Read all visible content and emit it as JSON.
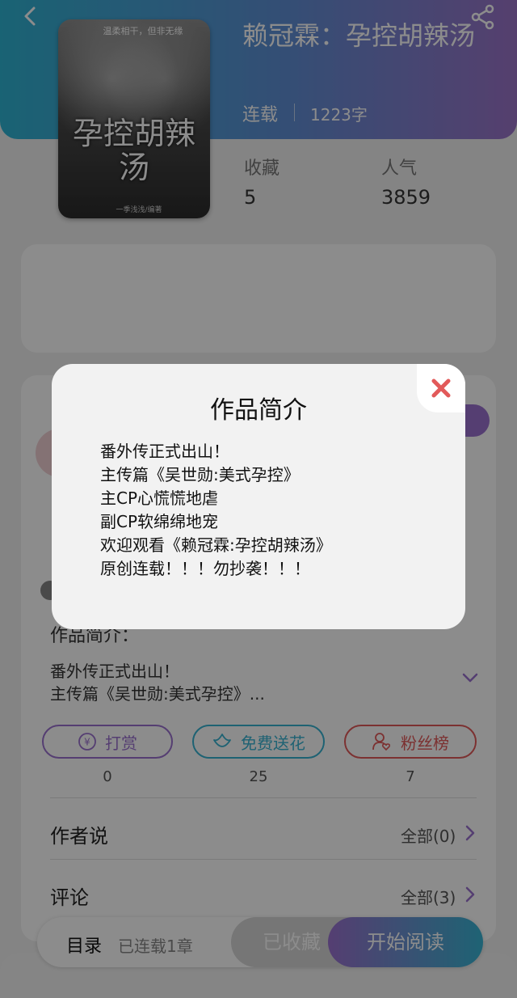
{
  "header": {
    "book_title": "赖冠霖：孕控胡辣汤",
    "status": "连载",
    "word_count": "1223字"
  },
  "cover": {
    "tagline": "温柔相干，但非无缘",
    "title": "孕控胡辣汤",
    "credit": "一季浅浅/编著"
  },
  "stats": {
    "favorites_label": "收藏",
    "favorites_value": "5",
    "popularity_label": "人气",
    "popularity_value": "3859"
  },
  "intro": {
    "heading": "作品简介：",
    "preview_line1": "番外传正式出山！",
    "preview_line2": "主传篇《吴世勋:美式孕控》..."
  },
  "actions": {
    "tip_label": "打赏",
    "tip_count": "0",
    "flower_label": "免费送花",
    "flower_count": "25",
    "fans_label": "粉丝榜",
    "fans_count": "7"
  },
  "sections": {
    "author_label": "作者说",
    "author_all": "全部(0)",
    "comment_label": "评论",
    "comment_all": "全部(3)"
  },
  "bottom_bar": {
    "toc_label": "目录",
    "toc_count": "已连载1章",
    "saved_label": "已收藏",
    "read_label": "开始阅读"
  },
  "modal": {
    "title": "作品简介",
    "lines": [
      "番外传正式出山！",
      "主传篇《吴世勋:美式孕控》",
      "主CP心慌慌地虐",
      "副CP软绵绵地宠",
      "欢迎观看《赖冠霖:孕控胡辣汤》",
      "原创连载！！！勿抄袭！！！"
    ]
  },
  "colors": {
    "accent_purple": "#9b72cf",
    "accent_cyan": "#37b3d2",
    "accent_red": "#e25a5a",
    "close_red": "#e25a5a"
  },
  "icons": {
    "back": "chevron-left-icon",
    "share": "share-icon",
    "tip": "yen-coin-icon",
    "flower": "flower-icon",
    "fans": "user-heart-icon",
    "expand": "chevron-down-icon",
    "arrow": "chevron-right-icon",
    "close": "close-icon"
  }
}
